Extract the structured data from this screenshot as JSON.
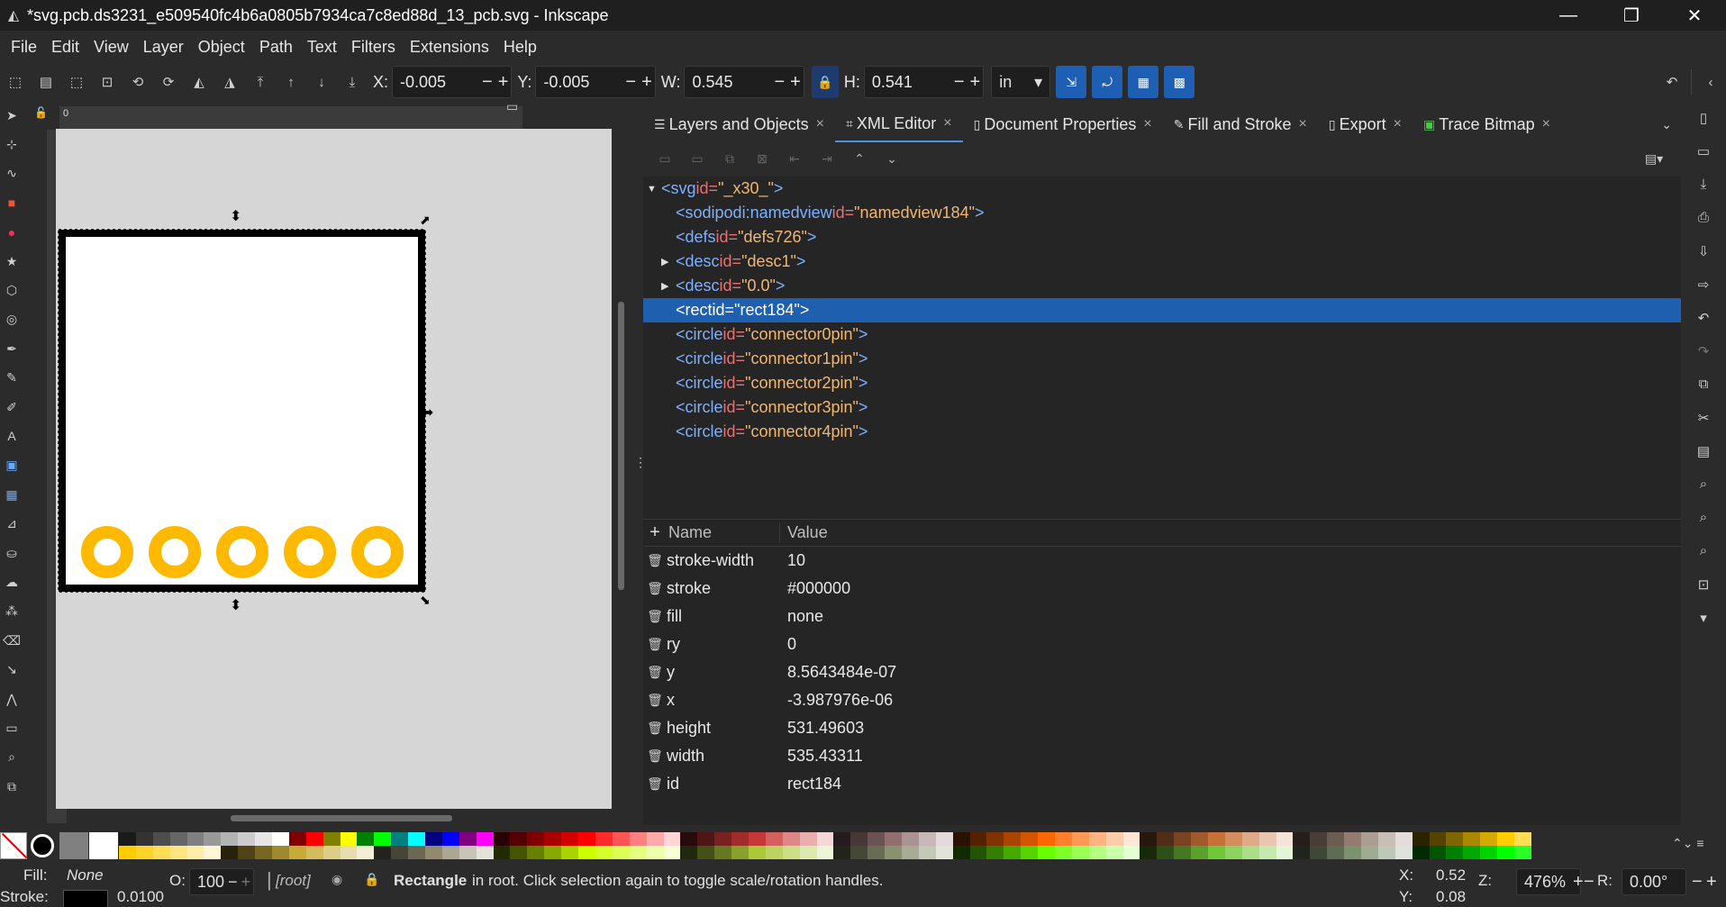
{
  "window": {
    "title": "*svg.pcb.ds3231_e509540fc4b6a0805b7934ca7c8ed88d_13_pcb.svg - Inkscape",
    "minimize": "—",
    "maximize": "❐",
    "close": "✕"
  },
  "menu": [
    "File",
    "Edit",
    "View",
    "Layer",
    "Object",
    "Path",
    "Text",
    "Filters",
    "Extensions",
    "Help"
  ],
  "toolbar": {
    "x_label": "X:",
    "x_value": "-0.005",
    "y_label": "Y:",
    "y_value": "-0.005",
    "w_label": "W:",
    "w_value": "0.545",
    "h_label": "H:",
    "h_value": "0.541",
    "unit": "in",
    "minus": "−",
    "plus": "+"
  },
  "ruler": {
    "origin": "0"
  },
  "panel": {
    "tabs": [
      {
        "label": "Layers and Objects",
        "icon": "layers-icon"
      },
      {
        "label": "XML Editor",
        "icon": "xml-icon"
      },
      {
        "label": "Document Properties",
        "icon": "document-icon"
      },
      {
        "label": "Fill and Stroke",
        "icon": "pen-icon"
      },
      {
        "label": "Export",
        "icon": "export-icon"
      },
      {
        "label": "Trace Bitmap",
        "icon": "trace-icon"
      }
    ],
    "active_tab": "XML Editor",
    "tree": [
      {
        "open": "<",
        "tag": "svg",
        "key": " id=",
        "val": "\"_x30_\"",
        "close": ">",
        "depth": 0,
        "expander": "down",
        "selected": false
      },
      {
        "open": "<",
        "tag": "sodipodi:namedview",
        "key": " id=",
        "val": "\"namedview184\"",
        "close": ">",
        "depth": 1,
        "expander": "none",
        "selected": false
      },
      {
        "open": "<",
        "tag": "defs",
        "key": " id=",
        "val": "\"defs726\"",
        "close": ">",
        "depth": 1,
        "expander": "none",
        "selected": false
      },
      {
        "open": "<",
        "tag": "desc",
        "key": " id=",
        "val": "\"desc1\"",
        "close": ">",
        "depth": 1,
        "expander": "right",
        "selected": false
      },
      {
        "open": "<",
        "tag": "desc",
        "key": " id=",
        "val": "\"0.0\"",
        "close": ">",
        "depth": 1,
        "expander": "right",
        "selected": false
      },
      {
        "open": "<",
        "tag": "rect",
        "key": " id=",
        "val": "\"rect184\"",
        "close": ">",
        "depth": 1,
        "expander": "none",
        "selected": true
      },
      {
        "open": "<",
        "tag": "circle",
        "key": " id=",
        "val": "\"connector0pin\"",
        "close": ">",
        "depth": 1,
        "expander": "none",
        "selected": false
      },
      {
        "open": "<",
        "tag": "circle",
        "key": " id=",
        "val": "\"connector1pin\"",
        "close": ">",
        "depth": 1,
        "expander": "none",
        "selected": false
      },
      {
        "open": "<",
        "tag": "circle",
        "key": " id=",
        "val": "\"connector2pin\"",
        "close": ">",
        "depth": 1,
        "expander": "none",
        "selected": false
      },
      {
        "open": "<",
        "tag": "circle",
        "key": " id=",
        "val": "\"connector3pin\"",
        "close": ">",
        "depth": 1,
        "expander": "none",
        "selected": false
      },
      {
        "open": "<",
        "tag": "circle",
        "key": " id=",
        "val": "\"connector4pin\"",
        "close": ">",
        "depth": 1,
        "expander": "none",
        "selected": false
      }
    ],
    "attr_header": {
      "add": "+",
      "name": "Name",
      "value": "Value"
    },
    "attributes": [
      {
        "name": "stroke-width",
        "value": "10"
      },
      {
        "name": "stroke",
        "value": "#000000"
      },
      {
        "name": "fill",
        "value": "none"
      },
      {
        "name": "ry",
        "value": "0"
      },
      {
        "name": "y",
        "value": "8.5643484e-07"
      },
      {
        "name": "x",
        "value": "-3.987976e-06"
      },
      {
        "name": "height",
        "value": "531.49603"
      },
      {
        "name": "width",
        "value": "535.43311"
      },
      {
        "name": "id",
        "value": "rect184"
      }
    ]
  },
  "canvas": {
    "board_fill": "#ffffff",
    "board_stroke": "#000000",
    "pad_color": "#ffb900",
    "pad_count": 5
  },
  "palette": {
    "row1": [
      "#1a1a1a",
      "#333333",
      "#4d4d4d",
      "#666666",
      "#808080",
      "#999999",
      "#b3b3b3",
      "#cccccc",
      "#e6e6e6",
      "#ffffff",
      "#800000",
      "#ff0000",
      "#808000",
      "#ffff00",
      "#008000",
      "#00ff00",
      "#008080",
      "#00ffff",
      "#000080",
      "#0000ff",
      "#800080",
      "#ff00ff",
      "#2b0000",
      "#550000",
      "#800000",
      "#aa0000",
      "#d40000",
      "#ff0000",
      "#ff2a2a",
      "#ff5555",
      "#ff8080",
      "#ffaaaa",
      "#ffd5d5",
      "#280b0b",
      "#501616",
      "#782121",
      "#a02c2c",
      "#c83737",
      "#d35f5f",
      "#de8787",
      "#e9afaf",
      "#f4d7d7",
      "#241c1c",
      "#483737",
      "#6c5353",
      "#916f6f",
      "#ac9393",
      "#c8b7b7",
      "#e3dbdb",
      "#2b1100",
      "#552200",
      "#803300",
      "#aa4400",
      "#d45500",
      "#ff6600",
      "#ff7f2a",
      "#ff9955",
      "#ffb380",
      "#ffccaa",
      "#ffe6d5",
      "#28170b",
      "#502d16",
      "#784421",
      "#a05a2c",
      "#c87137",
      "#d38d5f",
      "#deaa87",
      "#e9c6af",
      "#f4e3d7",
      "#241f1c",
      "#483e37",
      "#6c5d53",
      "#917c6f",
      "#ac9d93",
      "#c8beb7",
      "#e3dedb",
      "#2b2200",
      "#554400",
      "#806600",
      "#aa8800",
      "#d4aa00",
      "#ffcc00",
      "#ffdd55"
    ],
    "row2": [
      "#ffcc00",
      "#ffd42a",
      "#ffdd55",
      "#ffe680",
      "#ffeeaa",
      "#fff6d5",
      "#28220b",
      "#504416",
      "#786721",
      "#a0892c",
      "#c8ab37",
      "#d3bc5f",
      "#decd87",
      "#e9ddaf",
      "#f4eed7",
      "#24221c",
      "#484537",
      "#6c6753",
      "#918a6f",
      "#aca793",
      "#c8c4b7",
      "#e3e2db",
      "#222b00",
      "#445500",
      "#668000",
      "#88aa00",
      "#aad400",
      "#ccff00",
      "#d4ff2a",
      "#ddff55",
      "#e5ff80",
      "#eeffaa",
      "#f6ffd5",
      "#22280b",
      "#445016",
      "#677821",
      "#89a02c",
      "#abc837",
      "#bcd35f",
      "#cdde87",
      "#dde9af",
      "#eef4d7",
      "#22241c",
      "#454837",
      "#676c53",
      "#8a916f",
      "#a7ac93",
      "#c4c8b7",
      "#e2e3db",
      "#112b00",
      "#225500",
      "#338000",
      "#44aa00",
      "#55d400",
      "#66ff00",
      "#7fff2a",
      "#99ff55",
      "#b3ff80",
      "#ccffaa",
      "#e5ffd5",
      "#17280b",
      "#2d5016",
      "#447821",
      "#5aa02c",
      "#71c837",
      "#8dd35f",
      "#aade87",
      "#c6e9af",
      "#e3f4d7",
      "#1f241c",
      "#3e4837",
      "#5d6c53",
      "#7c916f",
      "#9dac93",
      "#bec8b7",
      "#dee3db",
      "#002b00",
      "#005500",
      "#008000",
      "#00aa00",
      "#00d400",
      "#00ff00",
      "#2aff2a"
    ]
  },
  "status": {
    "fill_label": "Fill:",
    "fill_value": "None",
    "stroke_label": "Stroke:",
    "stroke_width": "0.0100",
    "opacity_label": "O:",
    "opacity_value": "100",
    "layer": "[root]",
    "message_bold": "Rectangle",
    "message": " in root. Click selection again to toggle scale/rotation handles.",
    "cursor_x_label": "X:",
    "cursor_x": "0.52",
    "cursor_y_label": "Y:",
    "cursor_y": "0.08",
    "zoom_label": "Z:",
    "zoom_value": "476%",
    "rotation_label": "R:",
    "rotation_value": "0.00°"
  }
}
